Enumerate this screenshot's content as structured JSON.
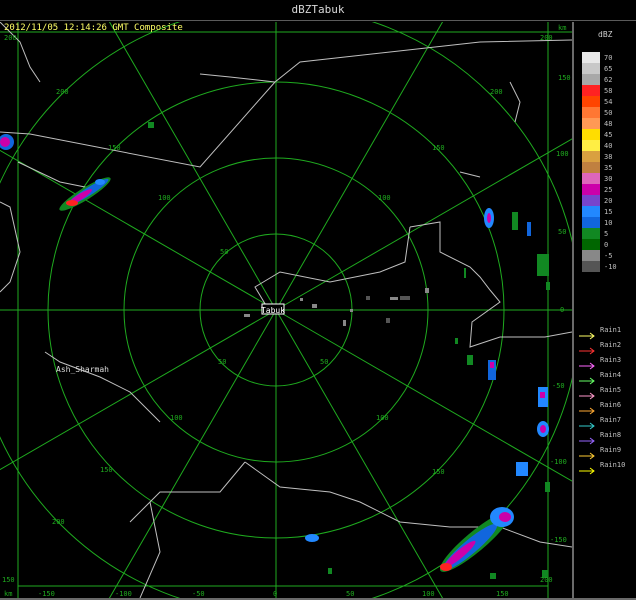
{
  "window": {
    "title": "dBZTabuk"
  },
  "plot": {
    "timestamp": "2012/11/05 12:14:26 GMT Composite",
    "km_unit_top": "km",
    "km_unit_bottom": "km",
    "station_label": "Tabuk",
    "city_label": "Ash_Sharmah",
    "x_axis_labels": [
      "-150",
      "-100",
      "-50",
      "0",
      "50",
      "100",
      "150"
    ],
    "y_axis_labels": [
      "150",
      "100",
      "50",
      "0",
      "-50",
      "-100",
      "-150"
    ],
    "corner_labels": {
      "top_left": "200",
      "top_right": "200",
      "bottom_left": "150",
      "bottom_right": "200"
    },
    "ring_labels": [
      "50",
      "100",
      "150",
      "200"
    ]
  },
  "scale": {
    "unit": "dBZ",
    "levels": [
      {
        "label": "70",
        "color": "#e8e8e8"
      },
      {
        "label": "65",
        "color": "#c8c8c8"
      },
      {
        "label": "62",
        "color": "#a8a8a8"
      },
      {
        "label": "58",
        "color": "#ff2222"
      },
      {
        "label": "54",
        "color": "#ff4400"
      },
      {
        "label": "50",
        "color": "#ff7733"
      },
      {
        "label": "48",
        "color": "#ff9955"
      },
      {
        "label": "45",
        "color": "#ffdd00"
      },
      {
        "label": "40",
        "color": "#ffee44"
      },
      {
        "label": "38",
        "color": "#d9a040"
      },
      {
        "label": "35",
        "color": "#c08040"
      },
      {
        "label": "30",
        "color": "#dd66bb"
      },
      {
        "label": "25",
        "color": "#cc00aa"
      },
      {
        "label": "20",
        "color": "#7744cc"
      },
      {
        "label": "15",
        "color": "#2288ff"
      },
      {
        "label": "10",
        "color": "#1166dd"
      },
      {
        "label": "5",
        "color": "#118822"
      },
      {
        "label": "0",
        "color": "#006600"
      },
      {
        "label": "-5",
        "color": "#888888"
      },
      {
        "label": "-10",
        "color": "#555555"
      }
    ]
  },
  "legend": [
    {
      "label": "Rain1",
      "color": "#ffff66"
    },
    {
      "label": "Rain2",
      "color": "#ff3333"
    },
    {
      "label": "Rain3",
      "color": "#ff66ff"
    },
    {
      "label": "Rain4",
      "color": "#66ff66"
    },
    {
      "label": "Rain5",
      "color": "#ff99cc"
    },
    {
      "label": "Rain6",
      "color": "#ffaa33"
    },
    {
      "label": "Rain7",
      "color": "#33cccc"
    },
    {
      "label": "Rain8",
      "color": "#9966ff"
    },
    {
      "label": "Rain9",
      "color": "#ffcc33"
    },
    {
      "label": "Rain10",
      "color": "#ffff00"
    }
  ]
}
